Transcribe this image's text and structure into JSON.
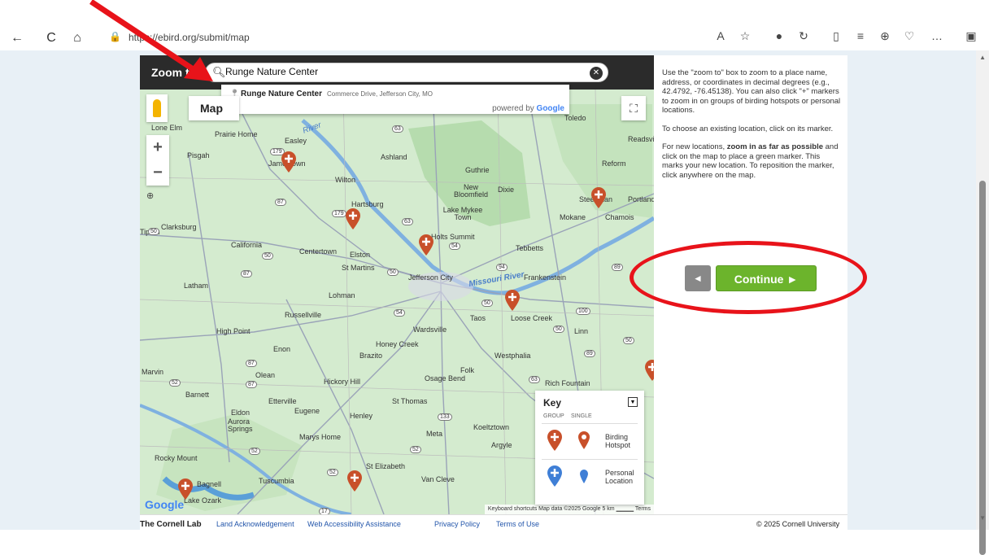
{
  "browser": {
    "url": "https://ebird.org/submit/map",
    "nav": {
      "back": "←",
      "reload": "C",
      "home": "⌂"
    },
    "toolbar_icons": [
      "A",
      "☆",
      "●",
      "↻",
      "▯",
      "≡",
      "⊕",
      "♡",
      "…",
      "▣"
    ]
  },
  "map": {
    "zoom_label": "Zoom to:",
    "search_value": "Runge Nature Center",
    "suggestion": {
      "name": "Runge Nature Center",
      "address": "Commerce Drive, Jefferson City, MO"
    },
    "powered_by": "powered by",
    "powered_brand": "Google",
    "map_type_label": "Map",
    "zoom_in": "+",
    "zoom_out": "−",
    "google_logo": "Google",
    "footer_text": "Keyboard shortcuts   Map data ©2025 Google   5 km ▁▁▁▁   Terms",
    "towns": [
      {
        "name": "Lone Elm"
      },
      {
        "name": "Prairie Home"
      },
      {
        "name": "Easley"
      },
      {
        "name": "Pisgah"
      },
      {
        "name": "Jamestown"
      },
      {
        "name": "Ashland"
      },
      {
        "name": "Guthrie"
      },
      {
        "name": "Reform"
      },
      {
        "name": "Wilton"
      },
      {
        "name": "New Bloomfield"
      },
      {
        "name": "Dixie"
      },
      {
        "name": "Steedman"
      },
      {
        "name": "Portland"
      },
      {
        "name": "Hartsburg"
      },
      {
        "name": "Lake Mykee Town"
      },
      {
        "name": "Mokane"
      },
      {
        "name": "Chamois"
      },
      {
        "name": "Clarksburg"
      },
      {
        "name": "Holts Summit"
      },
      {
        "name": "California"
      },
      {
        "name": "Centertown"
      },
      {
        "name": "Elston"
      },
      {
        "name": "Tebbetts"
      },
      {
        "name": "St Martins"
      },
      {
        "name": "Jefferson City"
      },
      {
        "name": "Frankenstein"
      },
      {
        "name": "Latham"
      },
      {
        "name": "Lohman"
      },
      {
        "name": "Loose Creek"
      },
      {
        "name": "Russellville"
      },
      {
        "name": "Taos"
      },
      {
        "name": "High Point"
      },
      {
        "name": "Wardsville"
      },
      {
        "name": "Linn"
      },
      {
        "name": "Honey Creek"
      },
      {
        "name": "Enon"
      },
      {
        "name": "Brazito"
      },
      {
        "name": "Westphalia"
      },
      {
        "name": "Folk"
      },
      {
        "name": "Marvin"
      },
      {
        "name": "Olean"
      },
      {
        "name": "Hickory Hill"
      },
      {
        "name": "Osage Bend"
      },
      {
        "name": "Rich Fountain"
      },
      {
        "name": "Barnett"
      },
      {
        "name": "Etterville"
      },
      {
        "name": "St Thomas"
      },
      {
        "name": "Eldon"
      },
      {
        "name": "Eugene"
      },
      {
        "name": "Henley"
      },
      {
        "name": "Aurora Springs"
      },
      {
        "name": "Koeltztown"
      },
      {
        "name": "Meta"
      },
      {
        "name": "Marys Home"
      },
      {
        "name": "Argyle"
      },
      {
        "name": "Rocky Mount"
      },
      {
        "name": "St Elizabeth"
      },
      {
        "name": "Tuscumbia"
      },
      {
        "name": "Van Cleve"
      },
      {
        "name": "Bagnell"
      },
      {
        "name": "Lake Ozark"
      },
      {
        "name": "Toledo"
      },
      {
        "name": "Readsville"
      },
      {
        "name": "Tipton"
      }
    ],
    "rivers": [
      "River",
      "Missouri River"
    ],
    "key": {
      "title": "Key",
      "toggle": "▼",
      "col_group": "GROUP",
      "col_single": "SINGLE",
      "birding_hotspot": "Birding Hotspot",
      "personal_location": "Personal Location"
    }
  },
  "sidebar": {
    "p1": "Use the \"zoom to\" box to zoom to a place name, address, or coordinates in decimal degrees (e.g., 42.4792, -76.45138). You can also click \"+\" markers to zoom in on groups of birding hotspots or personal locations.",
    "p2": "To choose an existing location, click on its marker.",
    "p3_pre": "For new locations, ",
    "p3_bold": "zoom in as far as possible",
    "p3_post": " and click on the map to place a green marker. This marks your new location. To reposition the marker, click anywhere on the map.",
    "back_label": "◄",
    "continue_label": "Continue ►"
  },
  "footer": {
    "brand": "The Cornell Lab",
    "links": [
      "Land Acknowledgement",
      "Web Accessibility Assistance",
      "Privacy Policy",
      "Terms of Use"
    ],
    "copyright": "© 2025 Cornell University"
  },
  "colors": {
    "continue": "#6cb42c",
    "hotspot": "#c8502a",
    "personal": "#3f7fd6",
    "annotation": "#e8131a"
  }
}
